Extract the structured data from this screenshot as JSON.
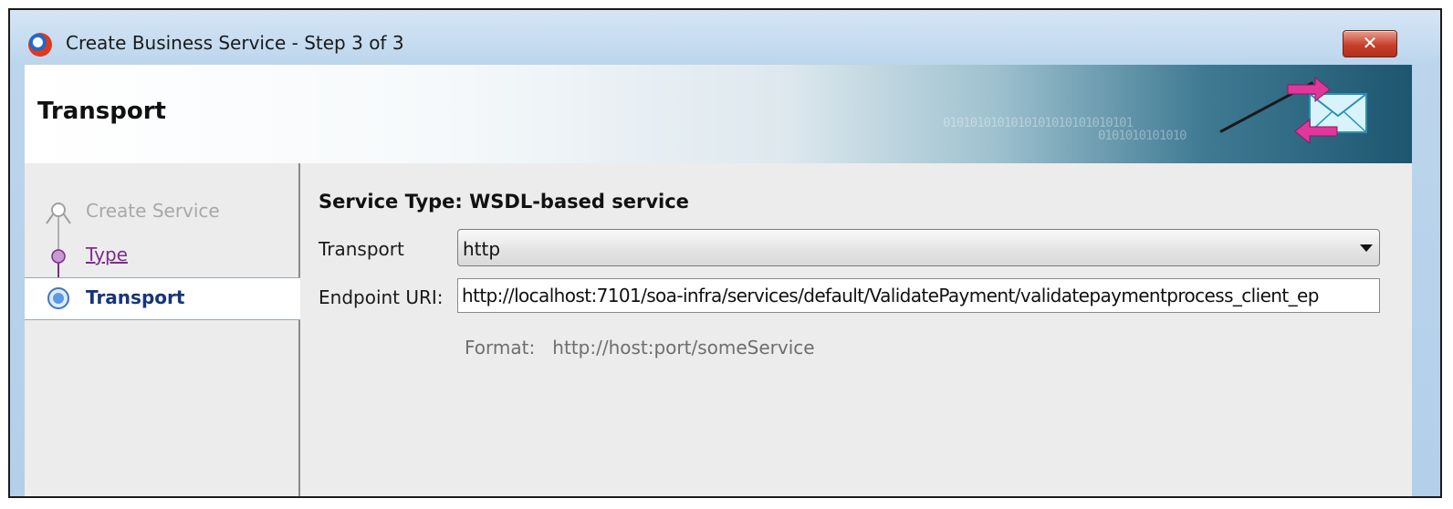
{
  "window": {
    "title": "Create Business Service - Step 3 of 3",
    "close_glyph": "✕"
  },
  "header": {
    "title": "Transport",
    "binary_line_1": "0101010101010101010101010101",
    "binary_line_2": "0101010101010",
    "icon": "envelope-transfer-icon"
  },
  "steps": [
    {
      "label": "Create Service",
      "state": "completed-disabled"
    },
    {
      "label": "Type",
      "state": "visited-link"
    },
    {
      "label": "Transport",
      "state": "current"
    }
  ],
  "content": {
    "section_heading": "Service Type: WSDL-based service",
    "transport_label": "Transport",
    "transport_value": "http",
    "endpoint_label": "Endpoint URI:",
    "endpoint_value": "http://localhost:7101/soa-infra/services/default/ValidatePayment/validatepaymentprocess_client_ep",
    "format_label": "Format:",
    "format_value": "http://host:port/someService"
  },
  "colors": {
    "step_link": "#7d2c8e",
    "step_current": "#16357a",
    "close_button": "#c7402b"
  }
}
